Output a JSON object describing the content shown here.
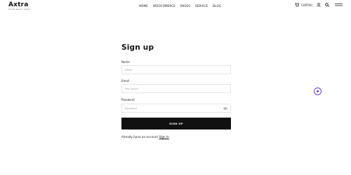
{
  "brand": {
    "name": "Axtra",
    "tagline": "DIGITAL AGENCY THEME"
  },
  "nav": [
    {
      "label": "HOME"
    },
    {
      "label": "WOOCOMERCE"
    },
    {
      "label": "PAGES"
    },
    {
      "label": "SERVICE"
    },
    {
      "label": "BLOG"
    }
  ],
  "header": {
    "cart_label": "CART(0)",
    "icons": [
      "cart-icon",
      "user-icon",
      "search-icon",
      "menu-icon"
    ]
  },
  "form": {
    "title": "Sign up",
    "name_label": "Name",
    "name_placeholder": "Name",
    "email_label": "Email",
    "email_placeholder": "Your email",
    "password_label": "Password",
    "password_placeholder": "Password",
    "submit_label": "SIGN UP",
    "already_text": "Already have an account",
    "signin_label": "Sign In"
  },
  "colors": {
    "accent": "#6b3fc8",
    "button": "#111111"
  }
}
